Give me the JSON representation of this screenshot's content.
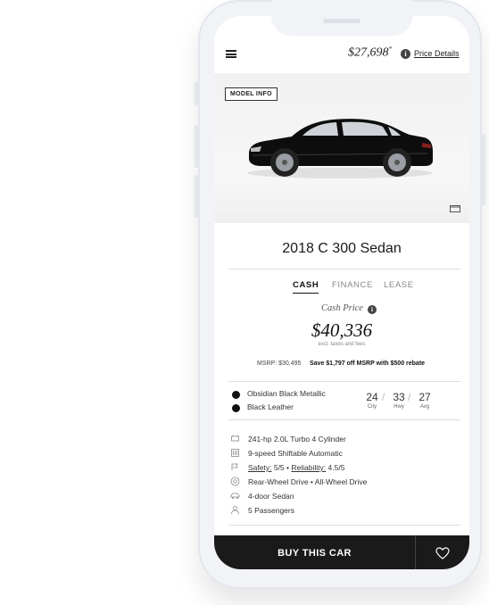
{
  "header": {
    "price": "$27,698",
    "price_sup": "*",
    "info_glyph": "i",
    "price_details": "Price Details"
  },
  "hero": {
    "model_info": "MODEL INFO",
    "car_color": "#0d0d0d"
  },
  "vehicle": {
    "title": "2018 C 300 Sedan"
  },
  "tabs": [
    "CASH",
    "FINANCE",
    "LEASE"
  ],
  "pricing": {
    "label": "Cash Price",
    "amount": "$40,336",
    "note": "excl. taxes and fees",
    "msrp": "MSRP: $30,495",
    "savings": "Save $1,797 off MSRP with $500 rebate"
  },
  "colors": {
    "exterior": "Obsidian Black Metallic",
    "interior": "Black Leather",
    "swatch": "#111111"
  },
  "mpg": {
    "city": "24",
    "city_label": "City",
    "hwy": "33",
    "hwy_label": "Hwy",
    "avg": "27",
    "avg_label": "Avg",
    "sep": "/"
  },
  "specs": {
    "engine": "241-hp 2.0L Turbo 4 Cylinder",
    "transmission": "9-speed Shiftable Automatic",
    "safety_label": "Safety:",
    "safety_value": "5/5",
    "bullet": "•",
    "reliability_label": "Reliability:",
    "reliability_value": "4.5/5",
    "drive": "Rear-Wheel Drive • All-Wheel Drive",
    "body": "4-door Sedan",
    "passengers": "5 Passengers"
  },
  "footer": {
    "buy_label": "BUY THIS CAR"
  },
  "icons": {
    "menu": "hamburger-menu-icon",
    "info": "info-icon",
    "gallery": "gallery-icon",
    "heart": "heart-icon"
  },
  "theme": {
    "dark_bar": "#1a1a1a",
    "accent": "#111111"
  }
}
